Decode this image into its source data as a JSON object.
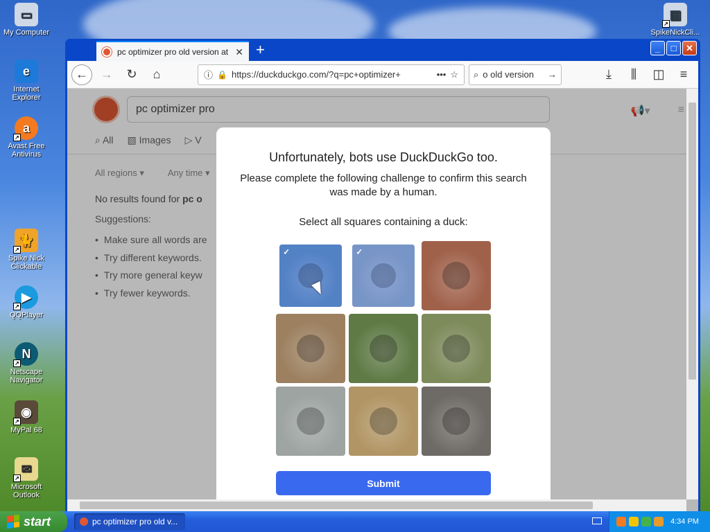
{
  "desktop": {
    "icons": [
      {
        "label": "My Computer"
      },
      {
        "label": "Internet Explorer"
      },
      {
        "label": "Avast Free Antivirus"
      },
      {
        "label": "Spike Nick Clickable"
      },
      {
        "label": "QQPlayer"
      },
      {
        "label": "Netscape Navigator"
      },
      {
        "label": "MyPal 68"
      },
      {
        "label": "Microsoft Outlook"
      },
      {
        "label": "SpikeNickCli..."
      }
    ]
  },
  "browser": {
    "tab_title": "pc optimizer pro old version at Duc",
    "url": "https://duckduckgo.com/?q=pc+optimizer+",
    "search_value": "o old version",
    "page": {
      "query": "pc optimizer pro",
      "tabs": [
        "All",
        "Images",
        "V"
      ],
      "filters": [
        "All regions",
        "Any time"
      ],
      "no_results_prefix": "No results found for",
      "no_results_query": "pc o",
      "suggestions_label": "Suggestions:",
      "suggestions": [
        "Make sure all words are",
        "Try different keywords.",
        "Try more general keyw",
        "Try fewer keywords."
      ]
    },
    "challenge": {
      "title": "Unfortunately, bots use DuckDuckGo too.",
      "subtitle": "Please complete the following challenge to confirm this search was made by a human.",
      "instruction": "Select all squares containing a duck:",
      "submit_label": "Submit",
      "tiles": [
        {
          "subject": "duck",
          "selected": true,
          "color": "#5b88b8"
        },
        {
          "subject": "duck",
          "selected": true,
          "color": "#8fa4bb"
        },
        {
          "subject": "monkey",
          "selected": false,
          "color": "#a0614a"
        },
        {
          "subject": "giraffes",
          "selected": false,
          "color": "#9c8060"
        },
        {
          "subject": "wild dog",
          "selected": false,
          "color": "#5f7a45"
        },
        {
          "subject": "squirrel",
          "selected": false,
          "color": "#7d8a5a"
        },
        {
          "subject": "duck",
          "selected": false,
          "color": "#9ea4a2"
        },
        {
          "subject": "bear cub",
          "selected": false,
          "color": "#b19564"
        },
        {
          "subject": "cat",
          "selected": false,
          "color": "#6e6a66"
        }
      ]
    }
  },
  "taskbar": {
    "start_label": "start",
    "task_label": "pc optimizer pro old v...",
    "clock": "4:34 PM"
  },
  "colors": {
    "accent": "#3969ef",
    "ddg_orange": "#de5833",
    "xp_blue": "#245edb"
  }
}
